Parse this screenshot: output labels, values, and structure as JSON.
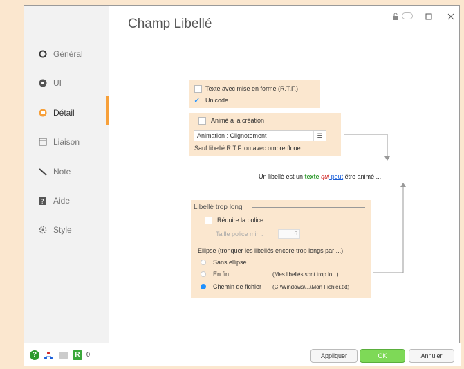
{
  "window": {
    "title": "Champ Libellé"
  },
  "sidebar": {
    "items": [
      {
        "label": "Général"
      },
      {
        "label": "UI"
      },
      {
        "label": "Détail"
      },
      {
        "label": "Liaison"
      },
      {
        "label": "Note"
      },
      {
        "label": "Aide"
      },
      {
        "label": "Style"
      }
    ],
    "active_index": 2
  },
  "rtf_panel": {
    "rtf_label": "Texte avec mise en forme (R.T.F.)",
    "unicode_label": "Unicode",
    "unicode_checked": true
  },
  "anim_panel": {
    "anim_label": "Animé à la création",
    "combo_value": "Animation : Clignotement",
    "note": "Sauf libellé R.T.F. ou avec ombre floue."
  },
  "preview": {
    "part1": "Un libellé est un ",
    "part2": "texte",
    "part3": " qui",
    "part4": " peut",
    "part5": " être animé ..."
  },
  "long_panel": {
    "title": "Libellé trop long",
    "reduce_label": "Réduire la police",
    "min_size_label": "Taille police min :",
    "min_size_value": "6",
    "ellipsis_label": "Ellipse (tronquer les libellés encore trop longs par ...)",
    "options": [
      {
        "label": "Sans ellipse",
        "example": "",
        "selected": false
      },
      {
        "label": "En fin",
        "example": "(Mes libellés sont trop lo...)",
        "selected": false
      },
      {
        "label": "Chemin de fichier",
        "example": "(C:\\Windows\\...\\Mon Fichier.txt)",
        "selected": true
      }
    ]
  },
  "footer": {
    "counter": "0",
    "apply_label": "Appliquer",
    "ok_label": "OK",
    "cancel_label": "Annuler"
  },
  "colors": {
    "accent": "#f7a03a",
    "ok": "#7ed957",
    "selected_radio": "#1e90ff"
  }
}
